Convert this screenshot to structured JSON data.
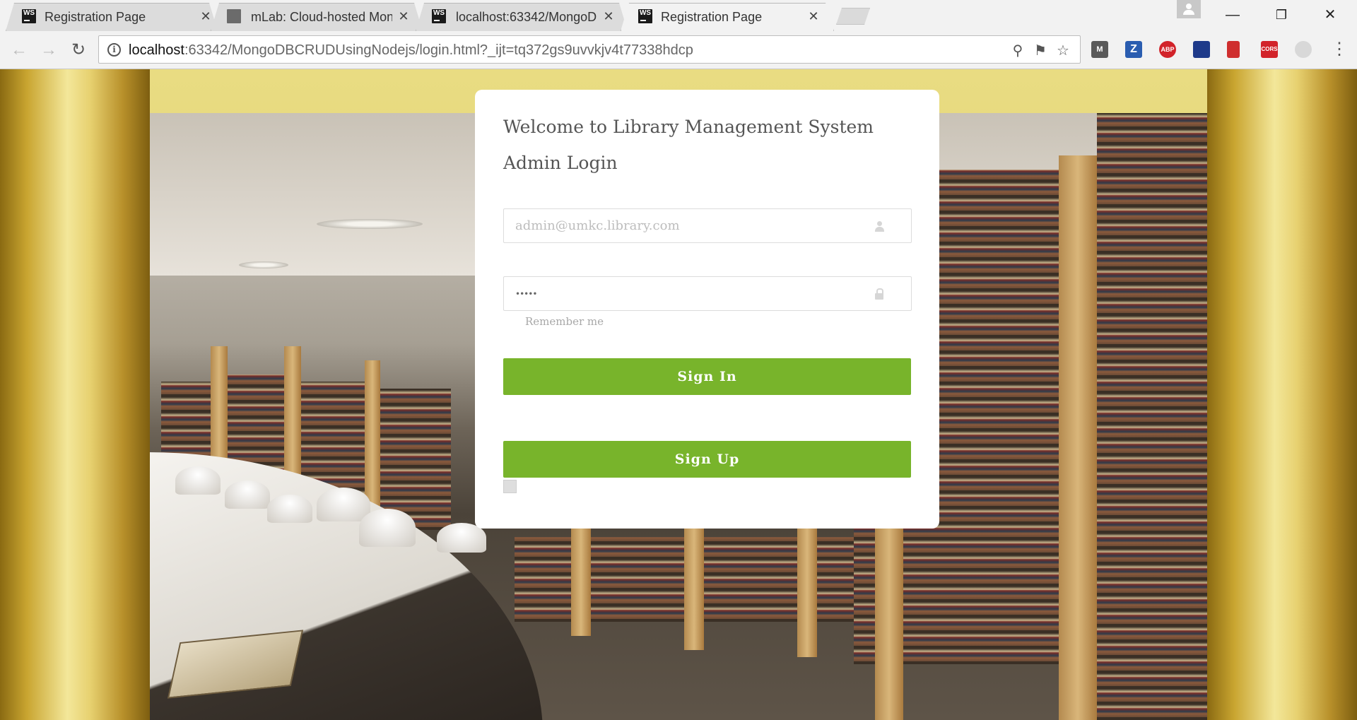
{
  "browser": {
    "tabs": [
      {
        "title": "Registration Page",
        "favicon": "ws-icon",
        "active": false
      },
      {
        "title": "mLab: Cloud-hosted Mon",
        "favicon": "mlab-icon",
        "active": false
      },
      {
        "title": "localhost:63342/MongoD",
        "favicon": "ws-icon",
        "active": false
      },
      {
        "title": "Registration Page",
        "favicon": "ws-icon",
        "active": true
      }
    ],
    "close_glyph": "✕",
    "favicon_text": "WS",
    "url_host": "localhost",
    "url_rest": ":63342/MongoDBCRUDUsingNodejs/login.html?_ijt=tq372gs9uvvkjv4t77338hdcp",
    "info_glyph": "i",
    "extensions": [
      {
        "name": "m-extension-icon",
        "label": "M",
        "color": "#5a5a5a"
      },
      {
        "name": "zotero-icon",
        "label": "Z",
        "color": "#2a5db0"
      },
      {
        "name": "abp-icon",
        "label": "ABP",
        "color": "#d2232a"
      },
      {
        "name": "user-extension-icon",
        "label": "",
        "color": "#1e3a8a"
      },
      {
        "name": "bookmark-extension-icon",
        "label": "",
        "color": "#cf2e2e"
      },
      {
        "name": "cors-icon",
        "label": "CORS",
        "color": "#d2232a"
      },
      {
        "name": "crescent-icon",
        "label": "",
        "color": "#d8d8d8"
      }
    ]
  },
  "login": {
    "title_line1": "Welcome to Library Management System",
    "title_line2": "Admin Login",
    "email_placeholder": "admin@umkc.library.com",
    "password_value": "•••••",
    "remember_label": "Remember me",
    "signin_label": "Sign In",
    "signup_label": "Sign Up",
    "accent_color": "#78b42b"
  }
}
